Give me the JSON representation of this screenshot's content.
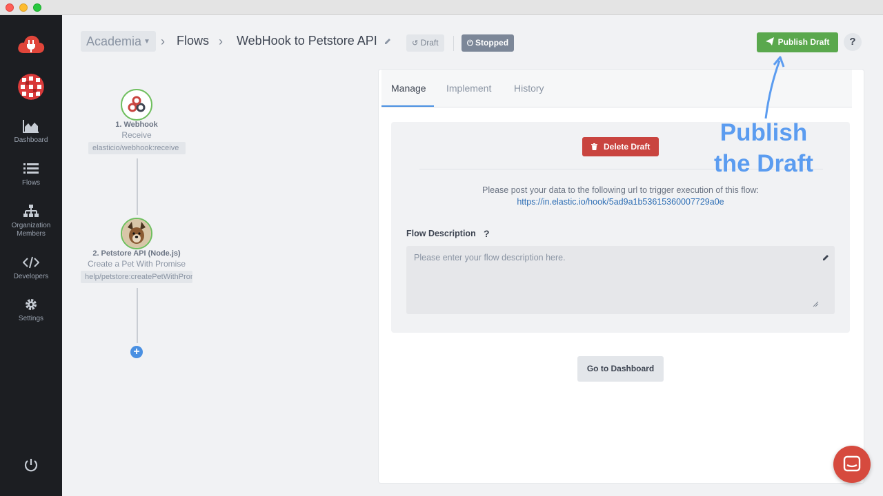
{
  "window": {
    "controls": [
      "close",
      "minimize",
      "zoom"
    ]
  },
  "sidebar": {
    "items": [
      {
        "label": "Dashboard",
        "icon": "area-chart-icon"
      },
      {
        "label": "Flows",
        "icon": "list-icon"
      },
      {
        "label": "Organization Members",
        "icon": "org-chart-icon"
      },
      {
        "label": "Developers",
        "icon": "code-icon"
      },
      {
        "label": "Settings",
        "icon": "gear-icon"
      }
    ],
    "power_icon": "power-icon"
  },
  "header": {
    "workspace": "Academia",
    "flows_crumb": "Flows",
    "flow_title": "WebHook to Petstore API",
    "draft_badge": "Draft",
    "status_badge": "Stopped",
    "publish_label": "Publish Draft",
    "help_label": "?"
  },
  "flow": {
    "nodes": [
      {
        "title": "1. Webhook",
        "subtitle": "Receive",
        "tag": "elasticio/webhook:receive"
      },
      {
        "title": "2. Petstore API (Node.js)",
        "subtitle": "Create a Pet With Promise",
        "tag": "help/petstore:createPetWithPromise"
      }
    ],
    "add_label": "+"
  },
  "tabs": [
    {
      "label": "Manage",
      "active": true
    },
    {
      "label": "Implement",
      "active": false
    },
    {
      "label": "History",
      "active": false
    }
  ],
  "manage": {
    "delete_label": "Delete Draft",
    "hint": "Please post your data to the following url to trigger execution of this flow:",
    "hook_url": "https://in.elastic.io/hook/5ad9a1b53615360007729a0e",
    "description_label": "Flow Description",
    "description_help": "?",
    "description_placeholder": "Please enter your flow description here.",
    "description_value": "",
    "dashboard_label": "Go to Dashboard"
  },
  "annotation": {
    "line1": "Publish",
    "line2": "the Draft"
  },
  "colors": {
    "sidebar_bg": "#1c1e22",
    "publish_green": "#5aa84d",
    "delete_red": "#c9443f",
    "link_blue": "#2f6fb5",
    "annotation_blue": "#5b9cf0",
    "status_gray": "#7c8798",
    "chat_red": "#d64a3e"
  }
}
